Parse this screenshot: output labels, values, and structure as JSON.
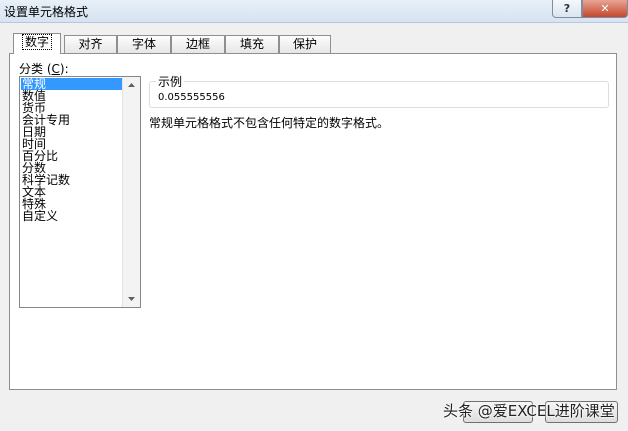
{
  "window": {
    "title": "设置单元格格式",
    "help_label": "?",
    "close_label": "✕"
  },
  "tabs": [
    {
      "label": "数字",
      "active": true
    },
    {
      "label": "对齐",
      "active": false
    },
    {
      "label": "字体",
      "active": false
    },
    {
      "label": "边框",
      "active": false
    },
    {
      "label": "填充",
      "active": false
    },
    {
      "label": "保护",
      "active": false
    }
  ],
  "category": {
    "label_prefix": "分类 (",
    "label_accel": "C",
    "label_suffix": "):",
    "items": [
      "常规",
      "数值",
      "货币",
      "会计专用",
      "日期",
      "时间",
      "百分比",
      "分数",
      "科学记数",
      "文本",
      "特殊",
      "自定义"
    ],
    "selected_index": 0
  },
  "sample": {
    "legend": "示例",
    "value": "0.055555556"
  },
  "description": "常规单元格格式不包含任何特定的数字格式。",
  "watermark": "头条 @爱EXCEL进阶课堂",
  "icons": {
    "scroll_up": "triangle-up-icon",
    "scroll_down": "triangle-down-icon"
  }
}
